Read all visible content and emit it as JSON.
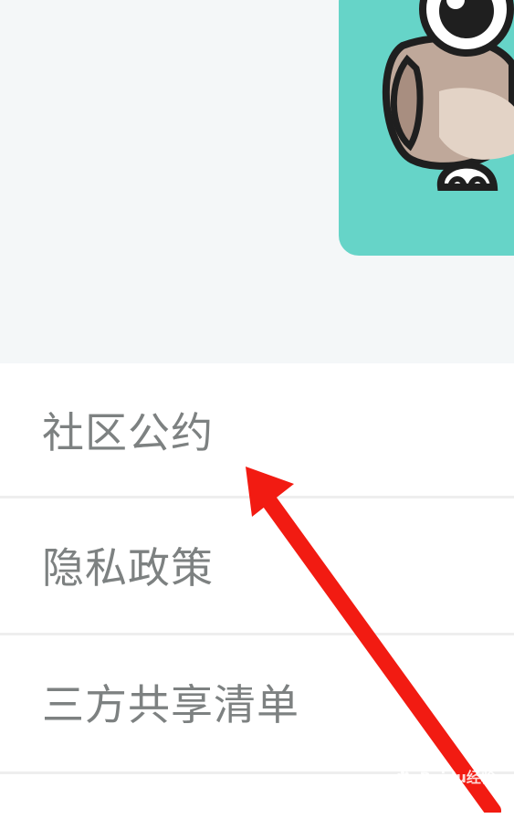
{
  "menu": {
    "items": [
      {
        "label": "社区公约"
      },
      {
        "label": "隐私政策"
      },
      {
        "label": "三方共享清单"
      }
    ]
  },
  "watermark": {
    "text": "Baidu经验"
  },
  "colors": {
    "top_bg": "#f4f7f8",
    "card_bg": "#66d4c8",
    "label_text": "#7d8181",
    "arrow": "#f21b12"
  },
  "icons": {
    "mascot": "owl-mascot-icon",
    "annotation": "red-arrow-icon"
  }
}
